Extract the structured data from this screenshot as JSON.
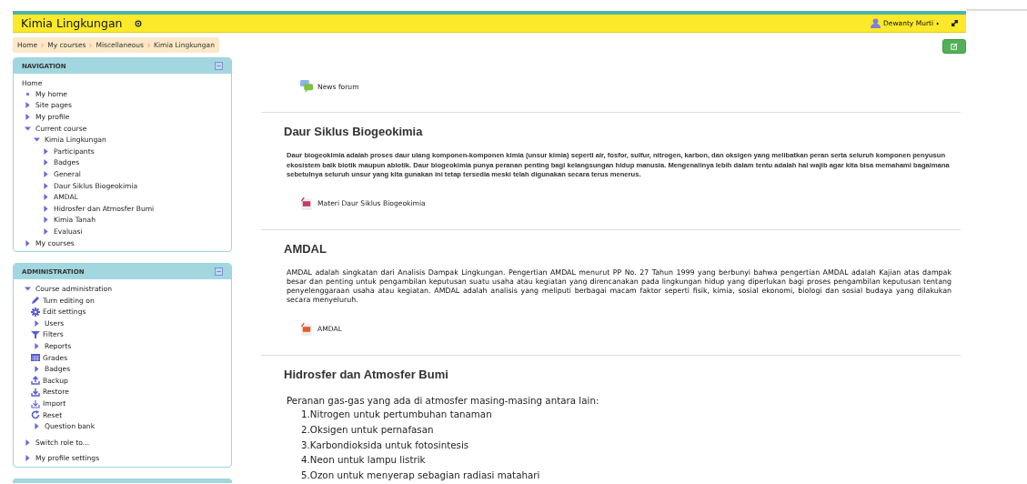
{
  "header": {
    "title": "Kimia Lingkungan",
    "user": "Dewanty Murti"
  },
  "breadcrumb": [
    "Home",
    "My courses",
    "Miscellaneous",
    "Kimia Lingkungan"
  ],
  "navigation": {
    "title": "NAVIGATION",
    "items": [
      {
        "label": "Home",
        "kind": "plain"
      },
      {
        "label": "My home",
        "kind": "leaf"
      },
      {
        "label": "Site pages",
        "kind": "branch",
        "expanded": false
      },
      {
        "label": "My profile",
        "kind": "branch",
        "expanded": false
      },
      {
        "label": "Current course",
        "kind": "branch",
        "expanded": true,
        "children": [
          {
            "label": "Kimia Lingkungan",
            "kind": "branch",
            "expanded": true,
            "children": [
              {
                "label": "Participants",
                "kind": "branch",
                "expanded": false
              },
              {
                "label": "Badges",
                "kind": "branch",
                "expanded": false
              },
              {
                "label": "General",
                "kind": "branch",
                "expanded": false
              },
              {
                "label": "Daur Siklus Biogeokimia",
                "kind": "branch",
                "expanded": false
              },
              {
                "label": "AMDAL",
                "kind": "branch",
                "expanded": false
              },
              {
                "label": "Hidrosfer dan Atmosfer Bumi",
                "kind": "branch",
                "expanded": false
              },
              {
                "label": "Kimia Tanah",
                "kind": "branch",
                "expanded": false
              },
              {
                "label": "Evaluasi",
                "kind": "branch",
                "expanded": false
              }
            ]
          }
        ]
      },
      {
        "label": "My courses",
        "kind": "branch",
        "expanded": false
      }
    ]
  },
  "administration": {
    "title": "ADMINISTRATION",
    "items": [
      {
        "label": "Course administration",
        "kind": "branch",
        "expanded": true,
        "children": [
          {
            "label": "Turn editing on",
            "kind": "edit"
          },
          {
            "label": "Edit settings",
            "kind": "settings"
          },
          {
            "label": "Users",
            "kind": "branch",
            "expanded": false
          },
          {
            "label": "Filters",
            "kind": "filter"
          },
          {
            "label": "Reports",
            "kind": "branch",
            "expanded": false
          },
          {
            "label": "Grades",
            "kind": "grades"
          },
          {
            "label": "Badges",
            "kind": "branch",
            "expanded": false
          },
          {
            "label": "Backup",
            "kind": "backup"
          },
          {
            "label": "Restore",
            "kind": "restore"
          },
          {
            "label": "Import",
            "kind": "import"
          },
          {
            "label": "Reset",
            "kind": "reset"
          },
          {
            "label": "Question bank",
            "kind": "branch",
            "expanded": false
          }
        ]
      },
      {
        "label": "Switch role to...",
        "kind": "branch",
        "expanded": false
      },
      {
        "label": "My profile settings",
        "kind": "branch",
        "expanded": false
      }
    ]
  },
  "sections": [
    {
      "activities": [
        {
          "label": "News forum",
          "kind": "forum"
        }
      ]
    },
    {
      "title": "Daur Siklus Biogeokimia",
      "kind": "condensed",
      "summary": [
        "Daur biogeokimia adalah proses daur ulang komponen-komponen kimia (unsur kimia) seperti air, fosfor, sulfur, nitrogen, karbon, dan oksigen yang melibatkan peran serta seluruh komponen penyusun ekosistem baik biotik maupun abiotik. Daur biogeokimia punya peranan penting bagi kelangsungan hidup manusia. Mengenalinya lebih dalam tentu adalah hal wajib agar kita bisa memahami bagaimana sebetulnya seluruh unsur yang kita gunakan ini tetap tersedia meski telah digunakan secara terus menerus."
      ],
      "activities": [
        {
          "label": "Materi Daur Siklus Biogeokimia",
          "kind": "file"
        }
      ]
    },
    {
      "title": "AMDAL",
      "kind": "justified",
      "summary": [
        "AMDAL adalah singkatan dari Analisis Dampak Lingkungan. Pengertian AMDAL menurut PP No. 27 Tahun 1999 yang berbunyi bahwa pengertian AMDAL adalah Kajian atas dampak besar dan penting untuk pengambilan keputusan suatu usaha atau kegiatan yang direncanakan pada lingkungan hidup yang diperlukan bagi proses pengambilan keputusan tentang penyelenggaraan usaha atau kegiatan. AMDAL adalah analisis yang meliputi berbagai macam faktor seperti fisik, kimia, sosial ekonomi, biologi dan sosial budaya yang dilakukan secara menyeluruh."
      ],
      "activities": [
        {
          "label": "AMDAL",
          "kind": "pdf"
        }
      ]
    },
    {
      "title": "Hidrosfer dan Atmosfer Bumi",
      "kind": "large",
      "summary": [
        "Peranan gas-gas yang ada di atmosfer masing-masing antara lain:"
      ],
      "list": [
        "1.Nitrogen untuk pertumbuhan tanaman",
        "2.Oksigen untuk pernafasan",
        "3.Karbondioksida untuk fotosintesis",
        "4.Neon untuk lampu listrik",
        "5.Ozon untuk menyerap sebagian radiasi matahari"
      ]
    }
  ]
}
